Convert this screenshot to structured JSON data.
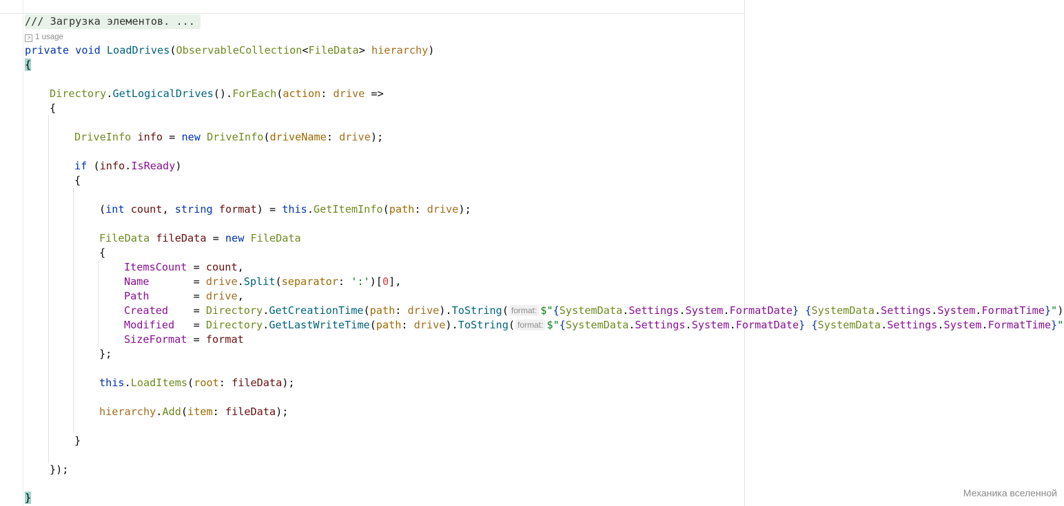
{
  "editor": {
    "doc_comment": "/// Загрузка элементов. ...",
    "usage_hint": "1 usage",
    "code": {
      "kw_private": "private",
      "kw_void": "void",
      "method_load_drives": "LoadDrives",
      "type_observable": "ObservableCollection",
      "type_filedata": "FileData",
      "param_hierarchy": "hierarchy",
      "open_brace": "{",
      "close_brace": "}",
      "type_directory": "Directory",
      "method_get_logical_drives": "GetLogicalDrives",
      "method_for_each": "ForEach",
      "named_action": "action",
      "param_drive": "drive",
      "arrow": "=>",
      "type_driveinfo": "DriveInfo",
      "local_info": "info",
      "kw_new": "new",
      "named_drive_name": "driveName",
      "kw_if": "if",
      "prop_is_ready": "IsReady",
      "kw_int": "int",
      "local_count": "count",
      "kw_string": "string",
      "local_format": "format",
      "kw_this": "this",
      "method_get_item_info": "GetItemInfo",
      "named_path": "path",
      "local_file_data": "fileData",
      "prop_items_count": "ItemsCount",
      "prop_name": "Name",
      "method_split": "Split",
      "named_separator": "separator",
      "char_colon": "':'",
      "num_zero": "0",
      "prop_path": "Path",
      "prop_created": "Created",
      "method_get_creation_time": "GetCreationTime",
      "method_to_string": "ToString",
      "hint_format": "format:",
      "str_open": "$\"",
      "str_close": "\"",
      "type_system_data": "SystemData",
      "prop_settings": "Settings",
      "prop_system": "System",
      "prop_format_date": "FormatDate",
      "prop_format_time": "FormatTime",
      "prop_modified": "Modified",
      "method_get_last_write_time": "GetLastWriteTime",
      "prop_size_format": "SizeFormat",
      "method_load_items": "LoadItems",
      "named_root": "root",
      "method_add": "Add",
      "named_item": "item"
    }
  },
  "watermark": "Механика вселенной"
}
